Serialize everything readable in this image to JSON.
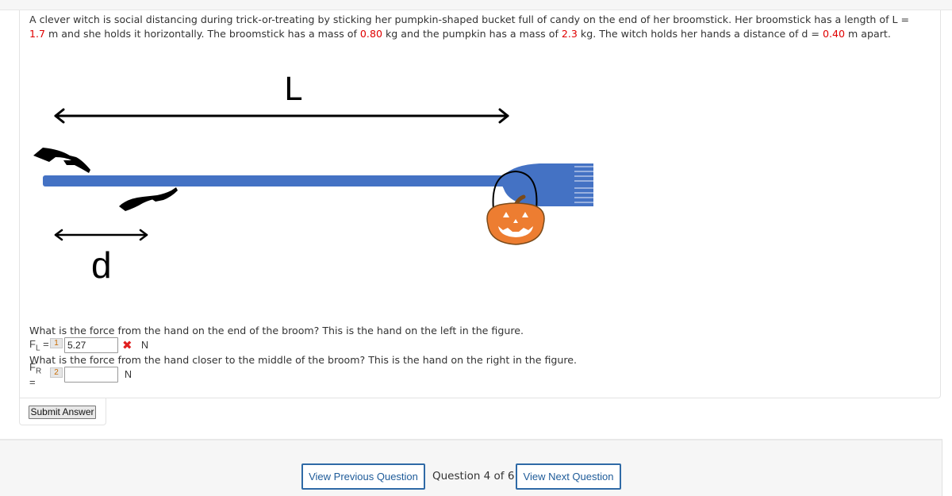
{
  "question": {
    "text_parts": [
      "A clever witch is social distancing during trick-or-treating by sticking her pumpkin-shaped bucket full of candy on the end of her broomstick. Her broomstick has a length of L = ",
      "1.7",
      " m and she holds it horizontally. The broomstick has a mass of ",
      "0.80",
      " kg and the pumpkin has a mass of ",
      "2.3",
      " kg. The witch holds her hands a distance of d = ",
      "0.40",
      " m apart."
    ],
    "highlight_color": "#e00000"
  },
  "figure": {
    "length_label": "L",
    "distance_label": "d",
    "broom_color": "#4472c4",
    "pumpkin_color": "#ed7d31"
  },
  "parts": [
    {
      "number": "1",
      "prompt": "What is the force from the hand on the end of the broom? This is the hand on the left in the figure.",
      "symbol": "F",
      "subscript": "L",
      "equals": "=",
      "value": "5.27",
      "status": "incorrect",
      "status_icon": "✖",
      "unit": "N"
    },
    {
      "number": "2",
      "prompt": "What is the force from the hand closer to the middle of the broom? This is the hand on the right in the figure.",
      "symbol": "F",
      "subscript": "R",
      "equals": "=",
      "value": "",
      "status": "unanswered",
      "unit": "N"
    }
  ],
  "submit_label": "Submit Answer",
  "navigation": {
    "prev_label": "View Previous Question",
    "position_label": "Question 4 of 6",
    "next_label": "View Next Question",
    "current": 4,
    "total": 6
  }
}
